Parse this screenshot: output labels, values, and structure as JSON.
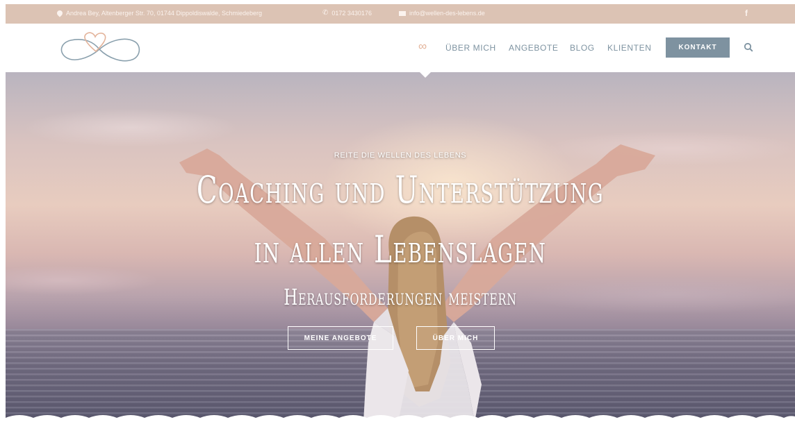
{
  "topbar": {
    "address": "Andrea Bey, Altenberger Str. 70, 01744 Dippoldiswalde, Schmiedeberg",
    "phone": "0172 3430176",
    "email": "info@wellen-des-lebens.de",
    "facebook": "f",
    "icons": {
      "address": "map-pin-icon",
      "phone": "phone-icon",
      "email": "envelope-icon",
      "facebook": "facebook-icon"
    }
  },
  "header": {
    "logo": "infinity-heart-logo",
    "nav": {
      "home_symbol": "∞",
      "items": [
        "ÜBER MICH",
        "ANGEBOTE",
        "BLOG",
        "KLIENTEN"
      ],
      "cta": "KONTAKT",
      "search_icon": "search-icon"
    }
  },
  "hero": {
    "tagline": "REITE DIE WELLEN DES LEBENS",
    "headline_line1": "Coaching und Unterstützung",
    "headline_line2": "in allen Lebenslagen",
    "subheadline": "Herausforderungen meistern",
    "buttons": [
      "MEINE ANGEBOTE",
      "ÜBER MICH"
    ]
  },
  "colors": {
    "topbar": "#dcc3b4",
    "nav_text": "#7e93a1",
    "accent": "#e3b39a",
    "cta_bg": "#7e92a0",
    "white": "#ffffff"
  }
}
